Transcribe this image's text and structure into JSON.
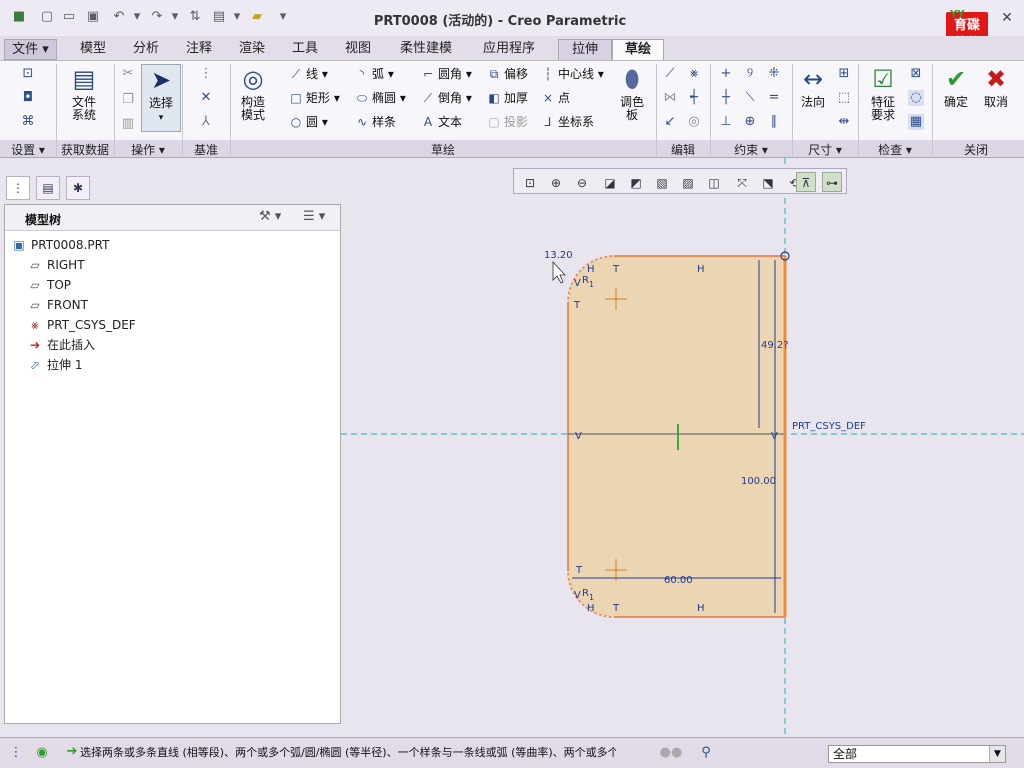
{
  "app": {
    "title": "PRT0008 (活动的) - Creo Parametric",
    "logo_top": "YY",
    "logo_line1": "育碟",
    "logo_line2": "软件"
  },
  "menu": {
    "file": "文件 ▾",
    "tabs": [
      "模型",
      "分析",
      "注释",
      "渲染",
      "工具",
      "视图",
      "柔性建模",
      "应用程序",
      "拉伸",
      "草绘"
    ]
  },
  "ribbon": {
    "file_system": "文件\n系统",
    "select": "选择",
    "construct_mode": "构造\n模式",
    "line": "线",
    "rectangle": "矩形",
    "circle": "圆",
    "arc": "弧",
    "ellipse": "椭圆",
    "spline": "样条",
    "fillet": "圆角",
    "chamfer": "倒角",
    "text": "文本",
    "offset": "偏移",
    "thicken": "加厚",
    "project": "投影",
    "centerline": "中心线",
    "point": "点",
    "coord_sys": "坐标系",
    "palette": "调色\n板",
    "normal": "法向",
    "feature_req": "特征\n要求",
    "ok": "确定",
    "cancel": "取消"
  },
  "groups": [
    "设置 ▾",
    "获取数据",
    "操作 ▾",
    "基准",
    "草绘",
    "编辑",
    "约束 ▾",
    "尺寸 ▾",
    "检查 ▾",
    "关闭"
  ],
  "tree": {
    "header": "模型树",
    "items": [
      "PRT0008.PRT",
      "RIGHT",
      "TOP",
      "FRONT",
      "PRT_CSYS_DEF",
      "在此插入",
      "拉伸 1"
    ]
  },
  "sketch": {
    "dim_radius": "13.20",
    "dim_vertical_upper": "49.2?",
    "dim_height": "100.00",
    "dim_width": "60.00",
    "csys_label": "PRT_CSYS_DEF",
    "constraint_h": "H",
    "constraint_t": "T",
    "constraint_v": "V",
    "radius_label": "R",
    "radius_sub": "1",
    "fill_color": "#ecd5b3",
    "line_color": "#e2783a",
    "dim_color": "#1e3d8f",
    "axis_color": "#18b3b3"
  },
  "status": {
    "message": "选择两条或多条直线 (相等段)、两个或多个弧/圆/椭圆 (等半径)、一个样条与一条线或弧 (等曲率)、两个或多个",
    "filter": "全部"
  }
}
